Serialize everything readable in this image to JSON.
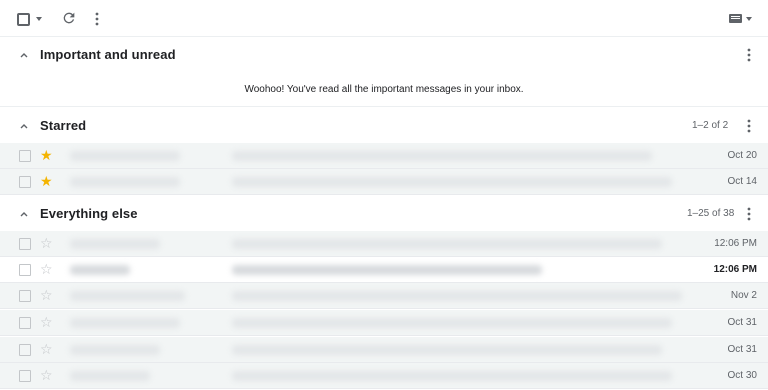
{
  "toolbar": {
    "select_all": "select-all-checkbox",
    "refresh": "refresh-icon",
    "more": "more-vert-icon",
    "input_tools": "keyboard-icon"
  },
  "sections": {
    "important": {
      "title": "Important and unread",
      "empty_message": "Woohoo! You've read all the important messages in your inbox."
    },
    "starred": {
      "title": "Starred",
      "count": "1–2 of 2",
      "rows": [
        {
          "date": "Oct 20",
          "starred": true,
          "unread": false
        },
        {
          "date": "Oct 14",
          "starred": true,
          "unread": false
        }
      ]
    },
    "everything": {
      "title": "Everything else",
      "count": "1–25 of 38",
      "rows": [
        {
          "date": "12:06 PM",
          "starred": false,
          "unread": false
        },
        {
          "date": "12:06 PM",
          "starred": false,
          "unread": true
        },
        {
          "date": "Nov 2",
          "starred": false,
          "unread": false
        },
        {
          "date": "Oct 31",
          "starred": false,
          "unread": false
        },
        {
          "date": "Oct 31",
          "starred": false,
          "unread": false
        },
        {
          "date": "Oct 30",
          "starred": false,
          "unread": false
        }
      ]
    }
  },
  "colors": {
    "star_on": "#f4b400",
    "star_off": "#c3c6c9",
    "read_row_bg": "#f2f5f5",
    "unread_row_bg": "#ffffff"
  }
}
